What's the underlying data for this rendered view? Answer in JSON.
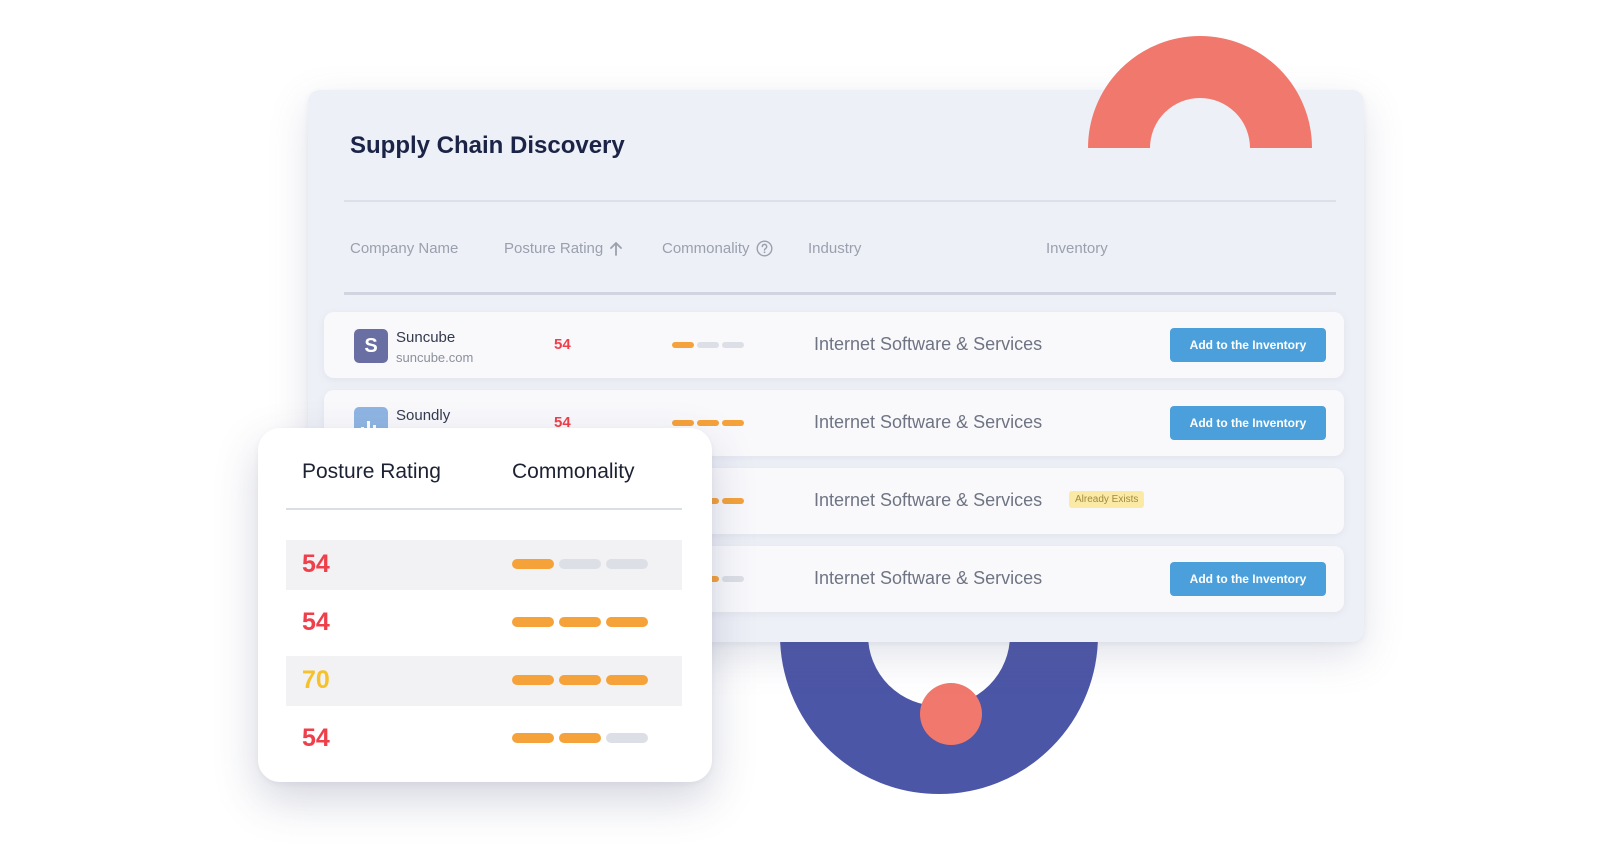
{
  "colors": {
    "coral": "#f1786c",
    "indigo": "#4c56a6",
    "rating_red": "#ef3f4a",
    "rating_yellow": "#f6c12a",
    "bar_filled": "#f5a23a",
    "bar_empty": "#dcdfe5",
    "button_blue": "#4ba0dc",
    "badge_yellow": "#fbe9a6"
  },
  "panel": {
    "title": "Supply Chain Discovery",
    "columns": {
      "company": "Company Name",
      "posture": "Posture Rating",
      "posture_icon": "arrow-up-icon",
      "commonality": "Commonality",
      "commonality_icon": "question-circle-icon",
      "industry": "Industry",
      "inventory": "Inventory"
    },
    "rows": [
      {
        "name": "Suncube",
        "domain": "suncube.com",
        "logo": "S",
        "rating": "54",
        "commonality": 1,
        "industry": "Internet Software & Services",
        "action": "Add to the Inventory"
      },
      {
        "name": "Soundly",
        "logo_icon": "bar-chart-logo-icon",
        "rating": "54",
        "commonality": 3,
        "industry": "Internet Software & Services",
        "action": "Add to the Inventory"
      },
      {
        "rating": "70",
        "commonality": 3,
        "industry": "Internet Software & Services",
        "badge": "Already Exists"
      },
      {
        "rating": "54",
        "commonality": 2,
        "industry": "Internet Software & Services",
        "action": "Add to the Inventory"
      }
    ]
  },
  "card": {
    "col_posture": "Posture Rating",
    "col_commonality": "Commonality",
    "rows": [
      {
        "rating": "54",
        "rating_color": "red",
        "commonality": 1
      },
      {
        "rating": "54",
        "rating_color": "red",
        "commonality": 3
      },
      {
        "rating": "70",
        "rating_color": "yellow",
        "commonality": 3
      },
      {
        "rating": "54",
        "rating_color": "red",
        "commonality": 2
      }
    ]
  }
}
